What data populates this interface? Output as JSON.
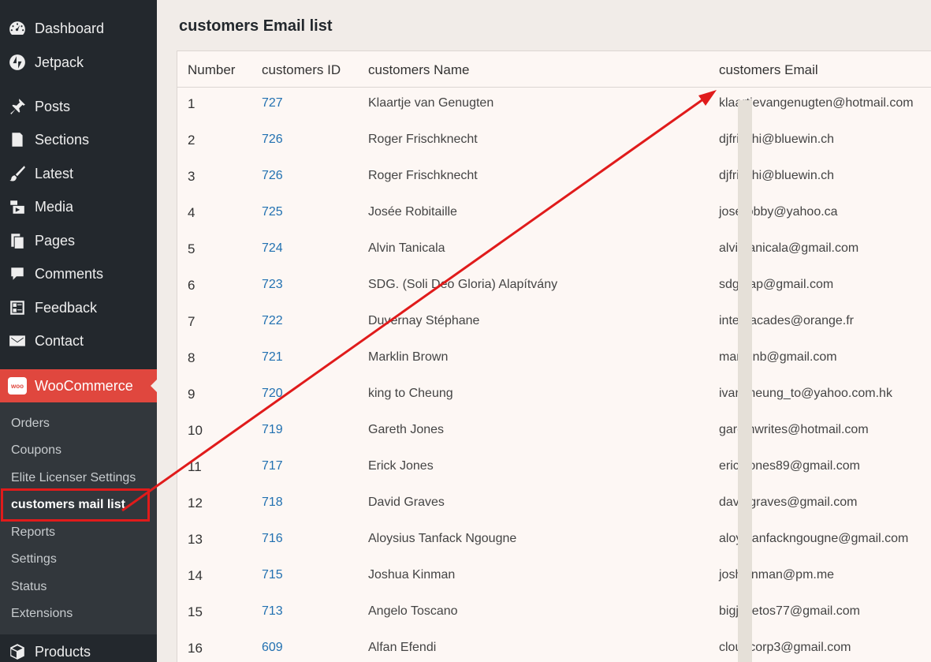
{
  "sidebar": {
    "items": [
      {
        "label": "Dashboard",
        "icon": "dashboard-icon"
      },
      {
        "label": "Jetpack",
        "icon": "jetpack-icon"
      },
      {
        "label": "Posts",
        "icon": "pin-icon"
      },
      {
        "label": "Sections",
        "icon": "document-icon"
      },
      {
        "label": "Latest",
        "icon": "brush-icon"
      },
      {
        "label": "Media",
        "icon": "media-icon"
      },
      {
        "label": "Pages",
        "icon": "pages-icon"
      },
      {
        "label": "Comments",
        "icon": "comment-icon"
      },
      {
        "label": "Feedback",
        "icon": "feedback-icon"
      },
      {
        "label": "Contact",
        "icon": "mail-icon"
      }
    ],
    "woocommerce": {
      "label": "WooCommerce",
      "badge": "woo"
    },
    "submenu": [
      "Orders",
      "Coupons",
      "Elite Licenser Settings",
      "customers mail list",
      "Reports",
      "Settings",
      "Status",
      "Extensions"
    ],
    "products": {
      "label": "Products"
    }
  },
  "page": {
    "title": "customers Email list"
  },
  "table": {
    "headers": [
      "Number",
      "customers ID",
      "customers Name",
      "customers Email"
    ],
    "rows": [
      {
        "n": "1",
        "id": "727",
        "name": "Klaartje van Genugten",
        "email": "klaartjevangenugten@hotmail.com"
      },
      {
        "n": "2",
        "id": "726",
        "name": "Roger Frischknecht",
        "email": "djfrischi@bluewin.ch"
      },
      {
        "n": "3",
        "id": "726",
        "name": "Roger Frischknecht",
        "email": "djfrischi@bluewin.ch"
      },
      {
        "n": "4",
        "id": "725",
        "name": "Josée Robitaille",
        "email": "joserobby@yahoo.ca"
      },
      {
        "n": "5",
        "id": "724",
        "name": "Alvin Tanicala",
        "email": "alvintanicala@gmail.com"
      },
      {
        "n": "6",
        "id": "723",
        "name": "SDG. (Soli Deo Gloria) Alapítvány",
        "email": "sdgalap@gmail.com"
      },
      {
        "n": "7",
        "id": "722",
        "name": "Duvernay Stéphane",
        "email": "intercacades@orange.fr"
      },
      {
        "n": "8",
        "id": "721",
        "name": "Marklin Brown",
        "email": "marklinb@gmail.com"
      },
      {
        "n": "9",
        "id": "720",
        "name": "king to Cheung",
        "email": "ivancheung_to@yahoo.com.hk"
      },
      {
        "n": "10",
        "id": "719",
        "name": "Gareth Jones",
        "email": "garethwrites@hotmail.com"
      },
      {
        "n": "11",
        "id": "717",
        "name": "Erick Jones",
        "email": "erickjones89@gmail.com"
      },
      {
        "n": "12",
        "id": "718",
        "name": "David Graves",
        "email": "davidgraves@gmail.com"
      },
      {
        "n": "13",
        "id": "716",
        "name": "Aloysius Tanfack Ngougne",
        "email": "aloystanfackngougne@gmail.com"
      },
      {
        "n": "14",
        "id": "715",
        "name": "Joshua Kinman",
        "email": "joshkinman@pm.me"
      },
      {
        "n": "15",
        "id": "713",
        "name": "Angelo Toscano",
        "email": "bigjaketos77@gmail.com"
      },
      {
        "n": "16",
        "id": "609",
        "name": "Alfan Efendi",
        "email": "cloudcorp3@gmail.com"
      }
    ]
  },
  "colors": {
    "sidebar_bg": "#23282d",
    "woo_accent": "#e0473e",
    "link": "#2271b1",
    "annotation": "#e01b1b"
  }
}
